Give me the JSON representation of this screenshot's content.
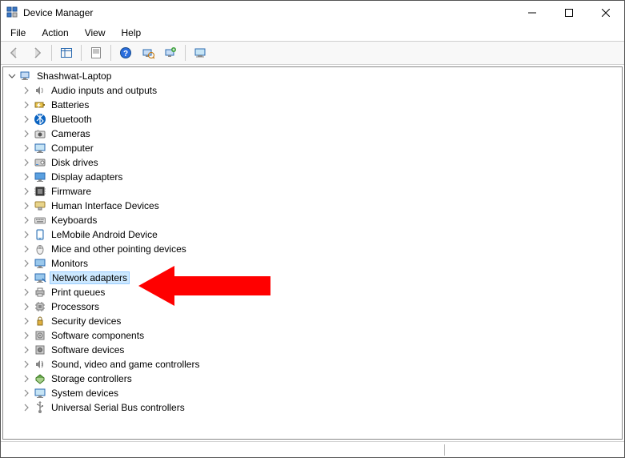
{
  "window": {
    "title": "Device Manager"
  },
  "menubar": {
    "items": [
      {
        "label": "File"
      },
      {
        "label": "Action"
      },
      {
        "label": "View"
      },
      {
        "label": "Help"
      }
    ]
  },
  "toolbar": {
    "back": "back-icon",
    "forward": "forward-icon",
    "show_hide": "show-hide-tree-icon",
    "properties": "properties-icon",
    "help": "help-icon",
    "scan": "scan-hardware-icon",
    "add_legacy": "add-legacy-icon",
    "devices": "devices-icon"
  },
  "tree": {
    "root": {
      "label": "Shashwat-Laptop",
      "expanded": true
    },
    "categories": [
      {
        "label": "Audio inputs and outputs",
        "icon": "speaker-icon",
        "expanded": false
      },
      {
        "label": "Batteries",
        "icon": "battery-icon",
        "expanded": false
      },
      {
        "label": "Bluetooth",
        "icon": "bluetooth-icon",
        "expanded": false
      },
      {
        "label": "Cameras",
        "icon": "camera-icon",
        "expanded": false
      },
      {
        "label": "Computer",
        "icon": "computer-icon",
        "expanded": false
      },
      {
        "label": "Disk drives",
        "icon": "disk-icon",
        "expanded": false
      },
      {
        "label": "Display adapters",
        "icon": "display-icon",
        "expanded": false
      },
      {
        "label": "Firmware",
        "icon": "firmware-icon",
        "expanded": false
      },
      {
        "label": "Human Interface Devices",
        "icon": "hid-icon",
        "expanded": false
      },
      {
        "label": "Keyboards",
        "icon": "keyboard-icon",
        "expanded": false
      },
      {
        "label": "LeMobile Android Device",
        "icon": "android-icon",
        "expanded": false
      },
      {
        "label": "Mice and other pointing devices",
        "icon": "mouse-icon",
        "expanded": false
      },
      {
        "label": "Monitors",
        "icon": "monitor-icon",
        "expanded": false
      },
      {
        "label": "Network adapters",
        "icon": "network-icon",
        "expanded": false,
        "selected": true
      },
      {
        "label": "Print queues",
        "icon": "printer-icon",
        "expanded": false
      },
      {
        "label": "Processors",
        "icon": "cpu-icon",
        "expanded": false
      },
      {
        "label": "Security devices",
        "icon": "security-icon",
        "expanded": false
      },
      {
        "label": "Software components",
        "icon": "software-comp-icon",
        "expanded": false
      },
      {
        "label": "Software devices",
        "icon": "software-dev-icon",
        "expanded": false
      },
      {
        "label": "Sound, video and game controllers",
        "icon": "sound-icon",
        "expanded": false
      },
      {
        "label": "Storage controllers",
        "icon": "storage-icon",
        "expanded": false
      },
      {
        "label": "System devices",
        "icon": "system-icon",
        "expanded": false
      },
      {
        "label": "Universal Serial Bus controllers",
        "icon": "usb-icon",
        "expanded": false
      }
    ]
  },
  "arrow": {
    "color": "#ff0000",
    "target": "Network adapters"
  }
}
